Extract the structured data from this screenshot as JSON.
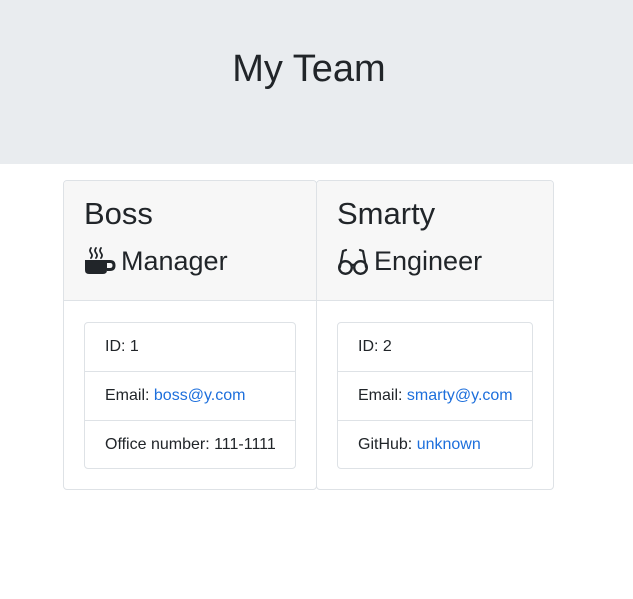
{
  "header": {
    "title": "My Team"
  },
  "employees": [
    {
      "name": "Boss",
      "role": "Manager",
      "role_icon": "coffee-icon",
      "id_label": "ID:",
      "id": "1",
      "email_label": "Email:",
      "email": "boss@y.com",
      "extra_label": "Office number:",
      "extra_value": "111-1111"
    },
    {
      "name": "Smarty",
      "role": "Engineer",
      "role_icon": "glasses-icon",
      "id_label": "ID:",
      "id": "2",
      "email_label": "Email:",
      "email": "smarty@y.com",
      "extra_label": "GitHub:",
      "extra_value": "unknown"
    }
  ],
  "colors": {
    "header_bg": "#e9ecef",
    "card_header_bg": "#f7f7f7",
    "link": "#1d6fdc",
    "border": "#dee2e6"
  }
}
